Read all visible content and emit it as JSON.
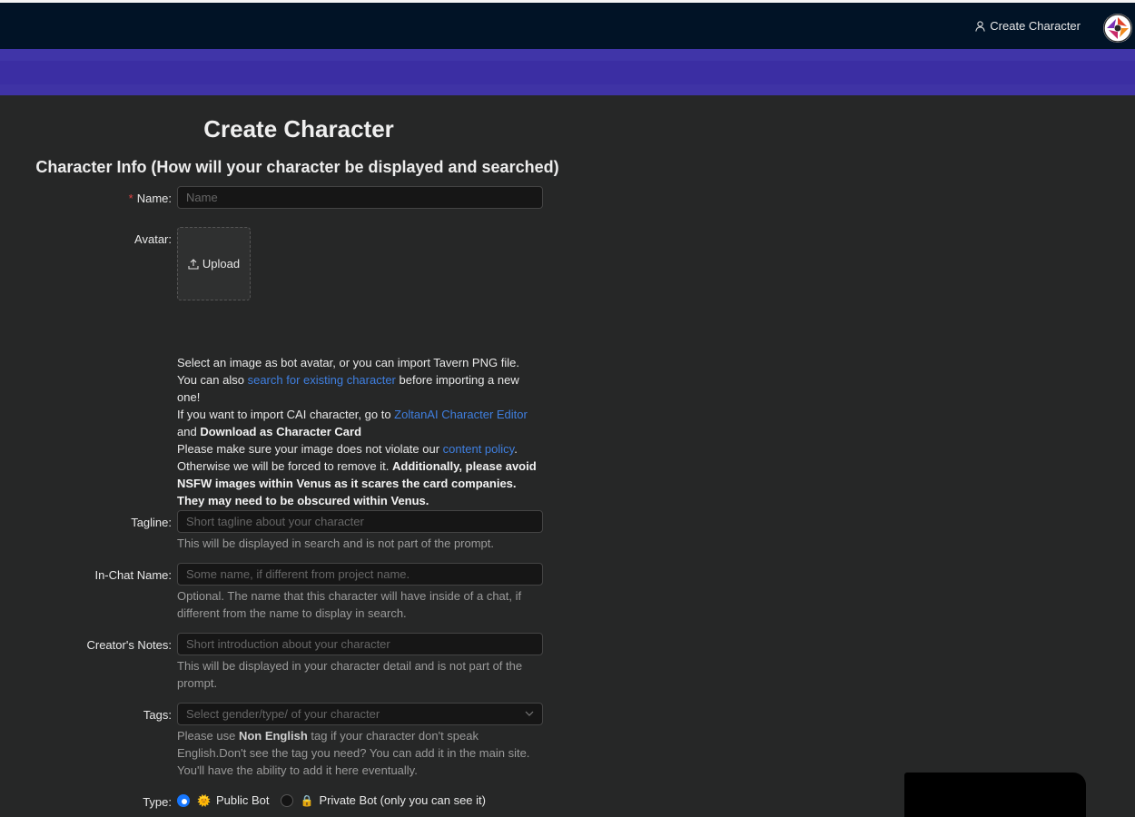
{
  "header": {
    "create_link": "Create Character",
    "icons": {
      "user": "user-icon",
      "avatar": "avatar-icon"
    }
  },
  "page": {
    "title": "Create Character",
    "section_title": "Character Info (How will your character be displayed and searched)"
  },
  "form": {
    "name": {
      "label": "Name:",
      "required_mark": "*",
      "placeholder": "Name"
    },
    "avatar": {
      "label": "Avatar:",
      "upload_label": "Upload",
      "desc": {
        "t1": "Select an image as bot avatar, or you can import Tavern PNG file. You can also ",
        "link1": "search for existing character",
        "t2": " before importing a new one!",
        "t3": "If you want to import CAI character, go to ",
        "link2": "ZoltanAI Character Editor",
        "t4": "and ",
        "bold1": "Download as Character Card",
        "t5": "Please make sure your image does not violate our ",
        "link3": "content policy",
        "t6": ". Otherwise we will be forced to remove it. ",
        "bold2": "Additionally, please avoid NSFW images within Venus as it scares the card companies. They may need to be obscured within Venus."
      }
    },
    "tagline": {
      "label": "Tagline:",
      "placeholder": "Short tagline about your character",
      "help": "This will be displayed in search and is not part of the prompt."
    },
    "in_chat_name": {
      "label": "In-Chat Name:",
      "placeholder": "Some name, if different from project name.",
      "help": "Optional. The name that this character will have inside of a chat, if different from the name to display in search."
    },
    "creators_notes": {
      "label": "Creator's Notes:",
      "placeholder": "Short introduction about your character",
      "help": "This will be displayed in your character detail and is not part of the prompt."
    },
    "tags": {
      "label": "Tags:",
      "placeholder": "Select gender/type/ of your character",
      "help_t1": "Please use ",
      "help_bold": "Non English",
      "help_t2": " tag if your character don't speak English.Don't see the tag you need? You can add it in the main site. You'll have the ability to add it here eventually."
    },
    "type": {
      "label": "Type:",
      "selected": "public",
      "public": {
        "emoji": "🌞",
        "label": "Public Bot"
      },
      "private": {
        "emoji": "🔒",
        "label": "Private Bot (only you can see it)"
      }
    }
  },
  "colors": {
    "header_bg": "#011326",
    "band": "#3a2c9c",
    "page_bg": "#262727",
    "link": "#3f7fe0",
    "accent": "#1677ff"
  }
}
